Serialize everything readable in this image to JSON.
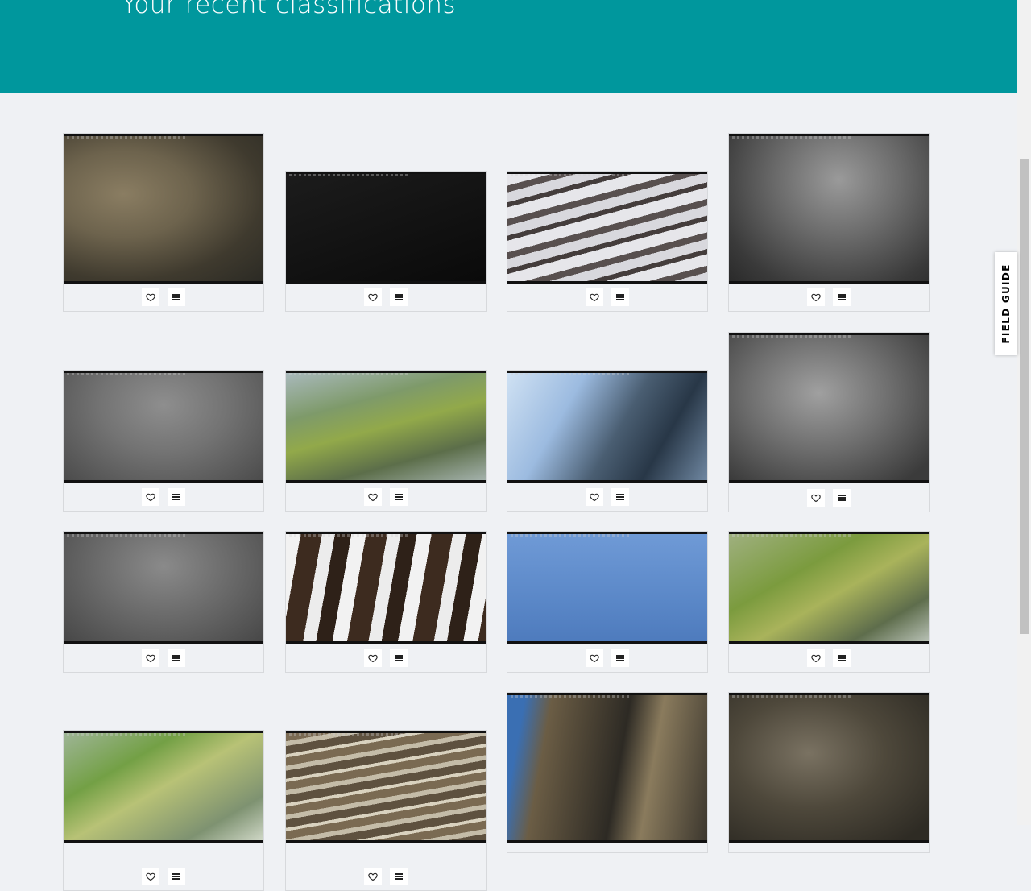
{
  "header": {
    "title": "Your recent classifications"
  },
  "field_guide": {
    "label": "FIELD GUIDE"
  },
  "colors": {
    "header_bg": "#00979d",
    "page_bg": "#eff1f4"
  },
  "icons": {
    "favorite": "heart-outline-icon",
    "collect": "list-menu-icon"
  },
  "classifications": [
    {
      "image": "brown rocky cliff face with blue sky"
    },
    {
      "image": "near-black night frame"
    },
    {
      "image": "cliff ledges covered in snow"
    },
    {
      "image": "grayscale night-vision cliff face"
    },
    {
      "image": "grey fog"
    },
    {
      "image": "mossy green cliff ledges"
    },
    {
      "image": "blue-tinted cliff with snow and mist"
    },
    {
      "image": "grayscale night-vision cliff face"
    },
    {
      "image": "grey fog"
    },
    {
      "image": "dark rock with patchy snow"
    },
    {
      "image": "plain blue sky"
    },
    {
      "image": "blurred green cliff"
    },
    {
      "image": "blurred green cliff"
    },
    {
      "image": "layered brown cliff with birds"
    },
    {
      "image": "cliff face with blue sky and shadow"
    },
    {
      "image": "dark cliff with nesting birds"
    }
  ]
}
